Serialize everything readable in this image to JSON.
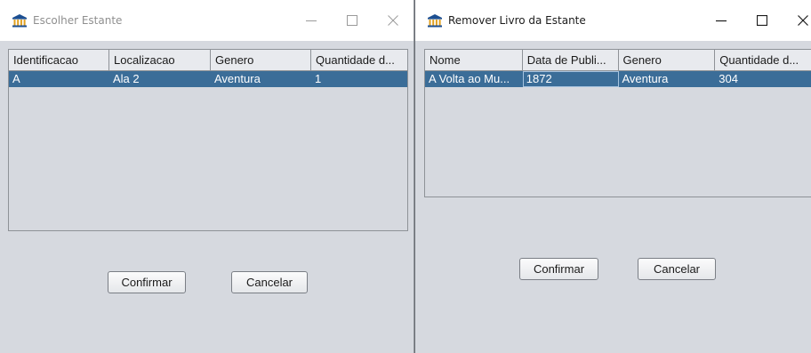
{
  "left_window": {
    "title": "Escolher Estante",
    "columns": [
      "Identificacao",
      "Localizacao",
      "Genero",
      "Quantidade d..."
    ],
    "rows": [
      [
        "A",
        "Ala 2",
        "Aventura",
        "1"
      ]
    ],
    "confirm_label": "Confirmar",
    "cancel_label": "Cancelar"
  },
  "right_window": {
    "title": "Remover Livro da Estante",
    "columns": [
      "Nome",
      "Data de Publi...",
      "Genero",
      "Quantidade d..."
    ],
    "rows": [
      [
        "A Volta ao Mu...",
        "1872",
        "Aventura",
        "304"
      ]
    ],
    "confirm_label": "Confirmar",
    "cancel_label": "Cancelar"
  },
  "icons": {
    "app": "bank-icon",
    "minimize": "minimize-icon",
    "maximize": "maximize-icon",
    "close": "close-icon"
  },
  "colors": {
    "selection": "#3b6d98",
    "background": "#d6d9df",
    "header": "#e8eaee"
  }
}
